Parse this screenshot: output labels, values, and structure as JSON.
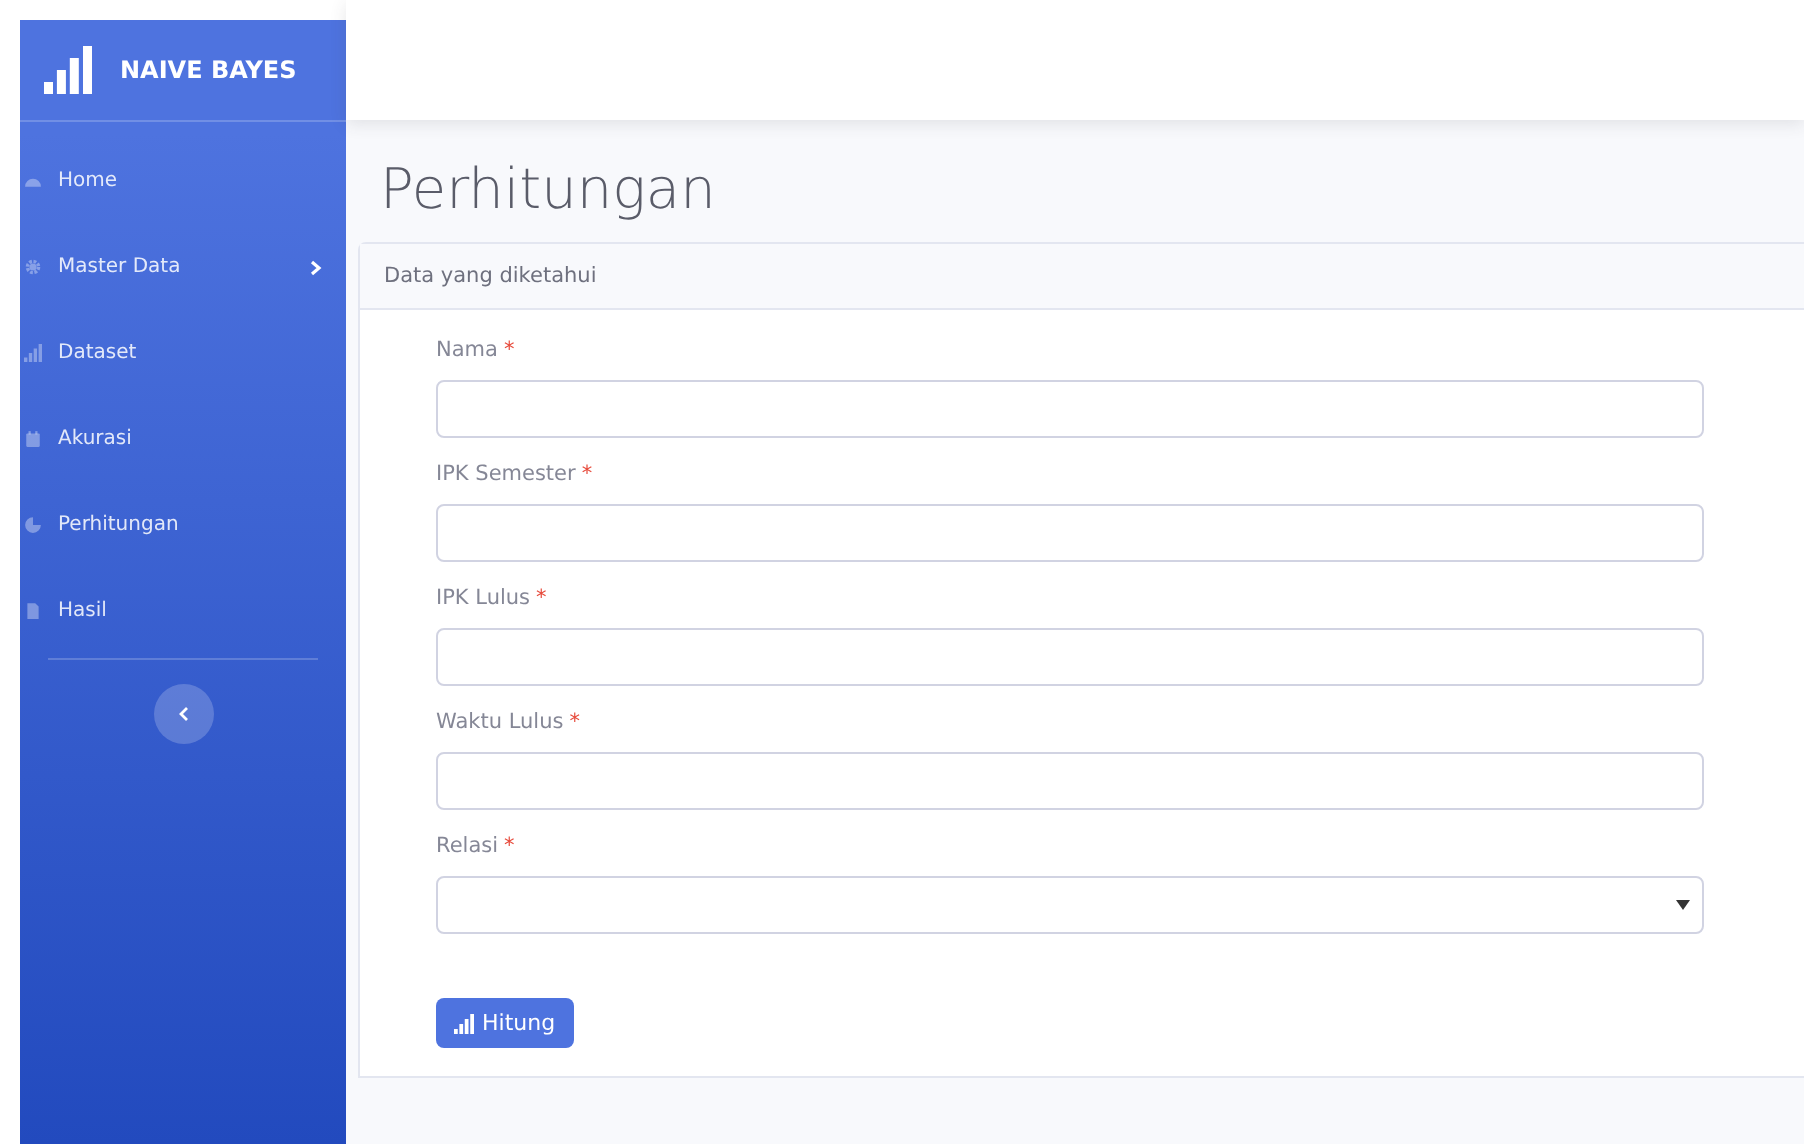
{
  "sidebar": {
    "brand": "NAIVE BAYES",
    "items": [
      {
        "label": "Home",
        "submenu": false
      },
      {
        "label": "Master Data",
        "submenu": true
      },
      {
        "label": "Dataset",
        "submenu": false
      },
      {
        "label": "Akurasi",
        "submenu": false
      },
      {
        "label": "Perhitungan",
        "submenu": false
      },
      {
        "label": "Hasil",
        "submenu": false
      }
    ]
  },
  "page": {
    "title": "Perhitungan"
  },
  "card": {
    "header": "Data yang diketahui",
    "fields": [
      {
        "label": "Nama",
        "kind": "text",
        "required_mark": "*"
      },
      {
        "label": "IPK Semester",
        "kind": "text",
        "required_mark": "*"
      },
      {
        "label": "IPK Lulus",
        "kind": "text",
        "required_mark": "*"
      },
      {
        "label": "Waktu Lulus",
        "kind": "text",
        "required_mark": "*"
      },
      {
        "label": "Relasi",
        "kind": "select",
        "required_mark": "*"
      }
    ],
    "button": "Hitung"
  }
}
